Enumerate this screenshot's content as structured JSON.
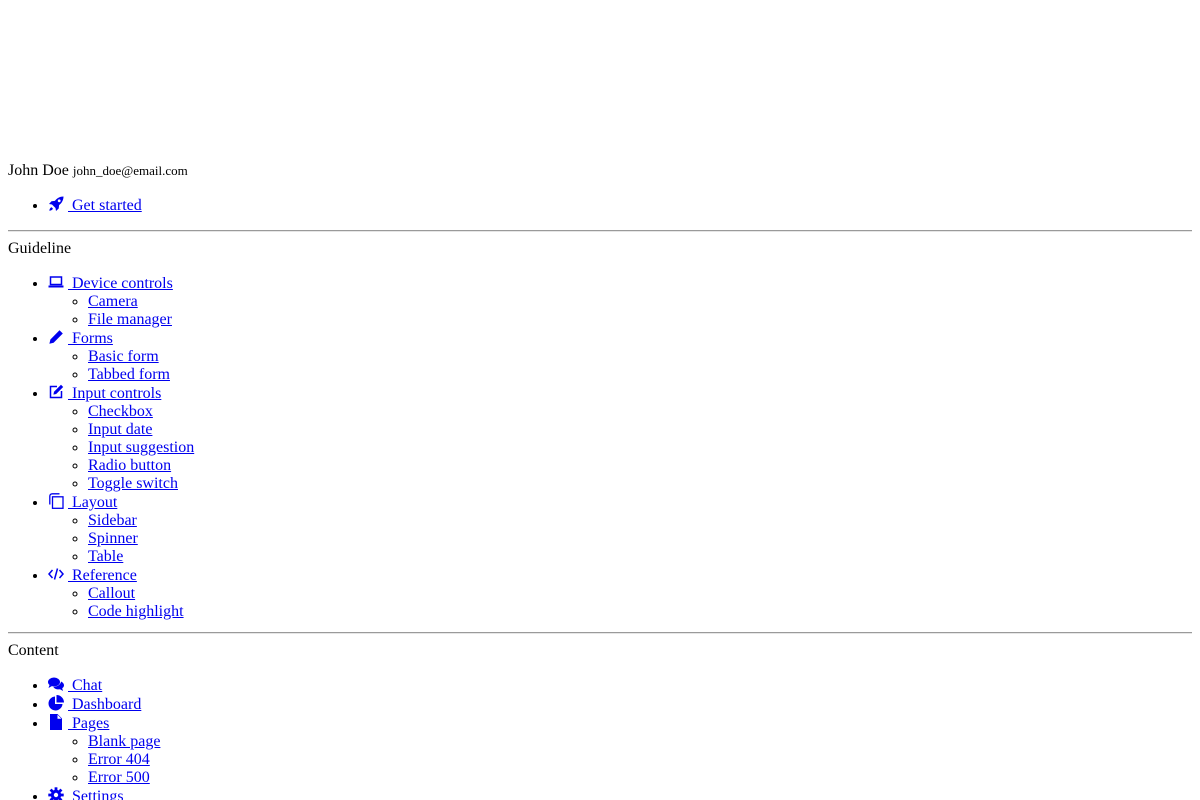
{
  "user": {
    "name": "John Doe",
    "email": "john_doe@email.com"
  },
  "top_nav": {
    "items": [
      {
        "label": " Get started",
        "icon": "rocket-icon"
      }
    ]
  },
  "guideline": {
    "heading": "Guideline",
    "groups": [
      {
        "label": " Device controls",
        "icon": "laptop-icon",
        "children": [
          "Camera",
          "File manager"
        ]
      },
      {
        "label": " Forms",
        "icon": "pencil-icon",
        "children": [
          "Basic form",
          "Tabbed form"
        ]
      },
      {
        "label": " Input controls",
        "icon": "edit-icon",
        "children": [
          "Checkbox",
          "Input date",
          "Input suggestion",
          "Radio button",
          "Toggle switch"
        ]
      },
      {
        "label": " Layout",
        "icon": "copy-icon",
        "children": [
          "Sidebar",
          "Spinner",
          "Table"
        ]
      },
      {
        "label": " Reference",
        "icon": "code-icon",
        "children": [
          "Callout",
          "Code highlight"
        ]
      }
    ]
  },
  "content": {
    "heading": "Content",
    "items": [
      {
        "label": " Chat",
        "icon": "comments-icon",
        "children": []
      },
      {
        "label": " Dashboard",
        "icon": "pie-chart-icon",
        "children": []
      },
      {
        "label": " Pages",
        "icon": "file-icon",
        "children": [
          "Blank page",
          "Error 404",
          "Error 500"
        ]
      },
      {
        "label": " Settings",
        "icon": "gear-icon",
        "children": []
      }
    ]
  },
  "colors": {
    "link": "#0000ee",
    "text": "#000000",
    "rule": "#9a9a9a"
  }
}
